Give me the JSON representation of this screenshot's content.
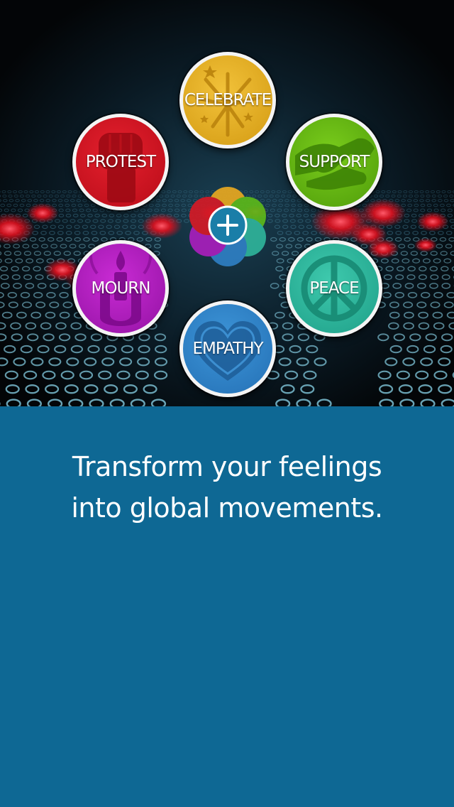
{
  "hero": {
    "add_button_symbol": "+",
    "feelings": [
      {
        "label": "CELEBRATE",
        "icon": "fireworks-icon",
        "color": "#e3ab1f"
      },
      {
        "label": "PROTEST",
        "icon": "raised-fist-icon",
        "color": "#d8141f"
      },
      {
        "label": "SUPPORT",
        "icon": "handshake-icon",
        "color": "#64b613"
      },
      {
        "label": "MOURN",
        "icon": "candle-hand-icon",
        "color": "#b01cbf"
      },
      {
        "label": "PEACE",
        "icon": "peace-sign-icon",
        "color": "#2db59a"
      },
      {
        "label": "EMPATHY",
        "icon": "heart-icon",
        "color": "#2f82c6"
      }
    ]
  },
  "tagline": {
    "line1": "Transform your feelings",
    "line2": "into global movements."
  },
  "colors": {
    "background_blue": "#0e6894",
    "hero_background": "#040608"
  }
}
